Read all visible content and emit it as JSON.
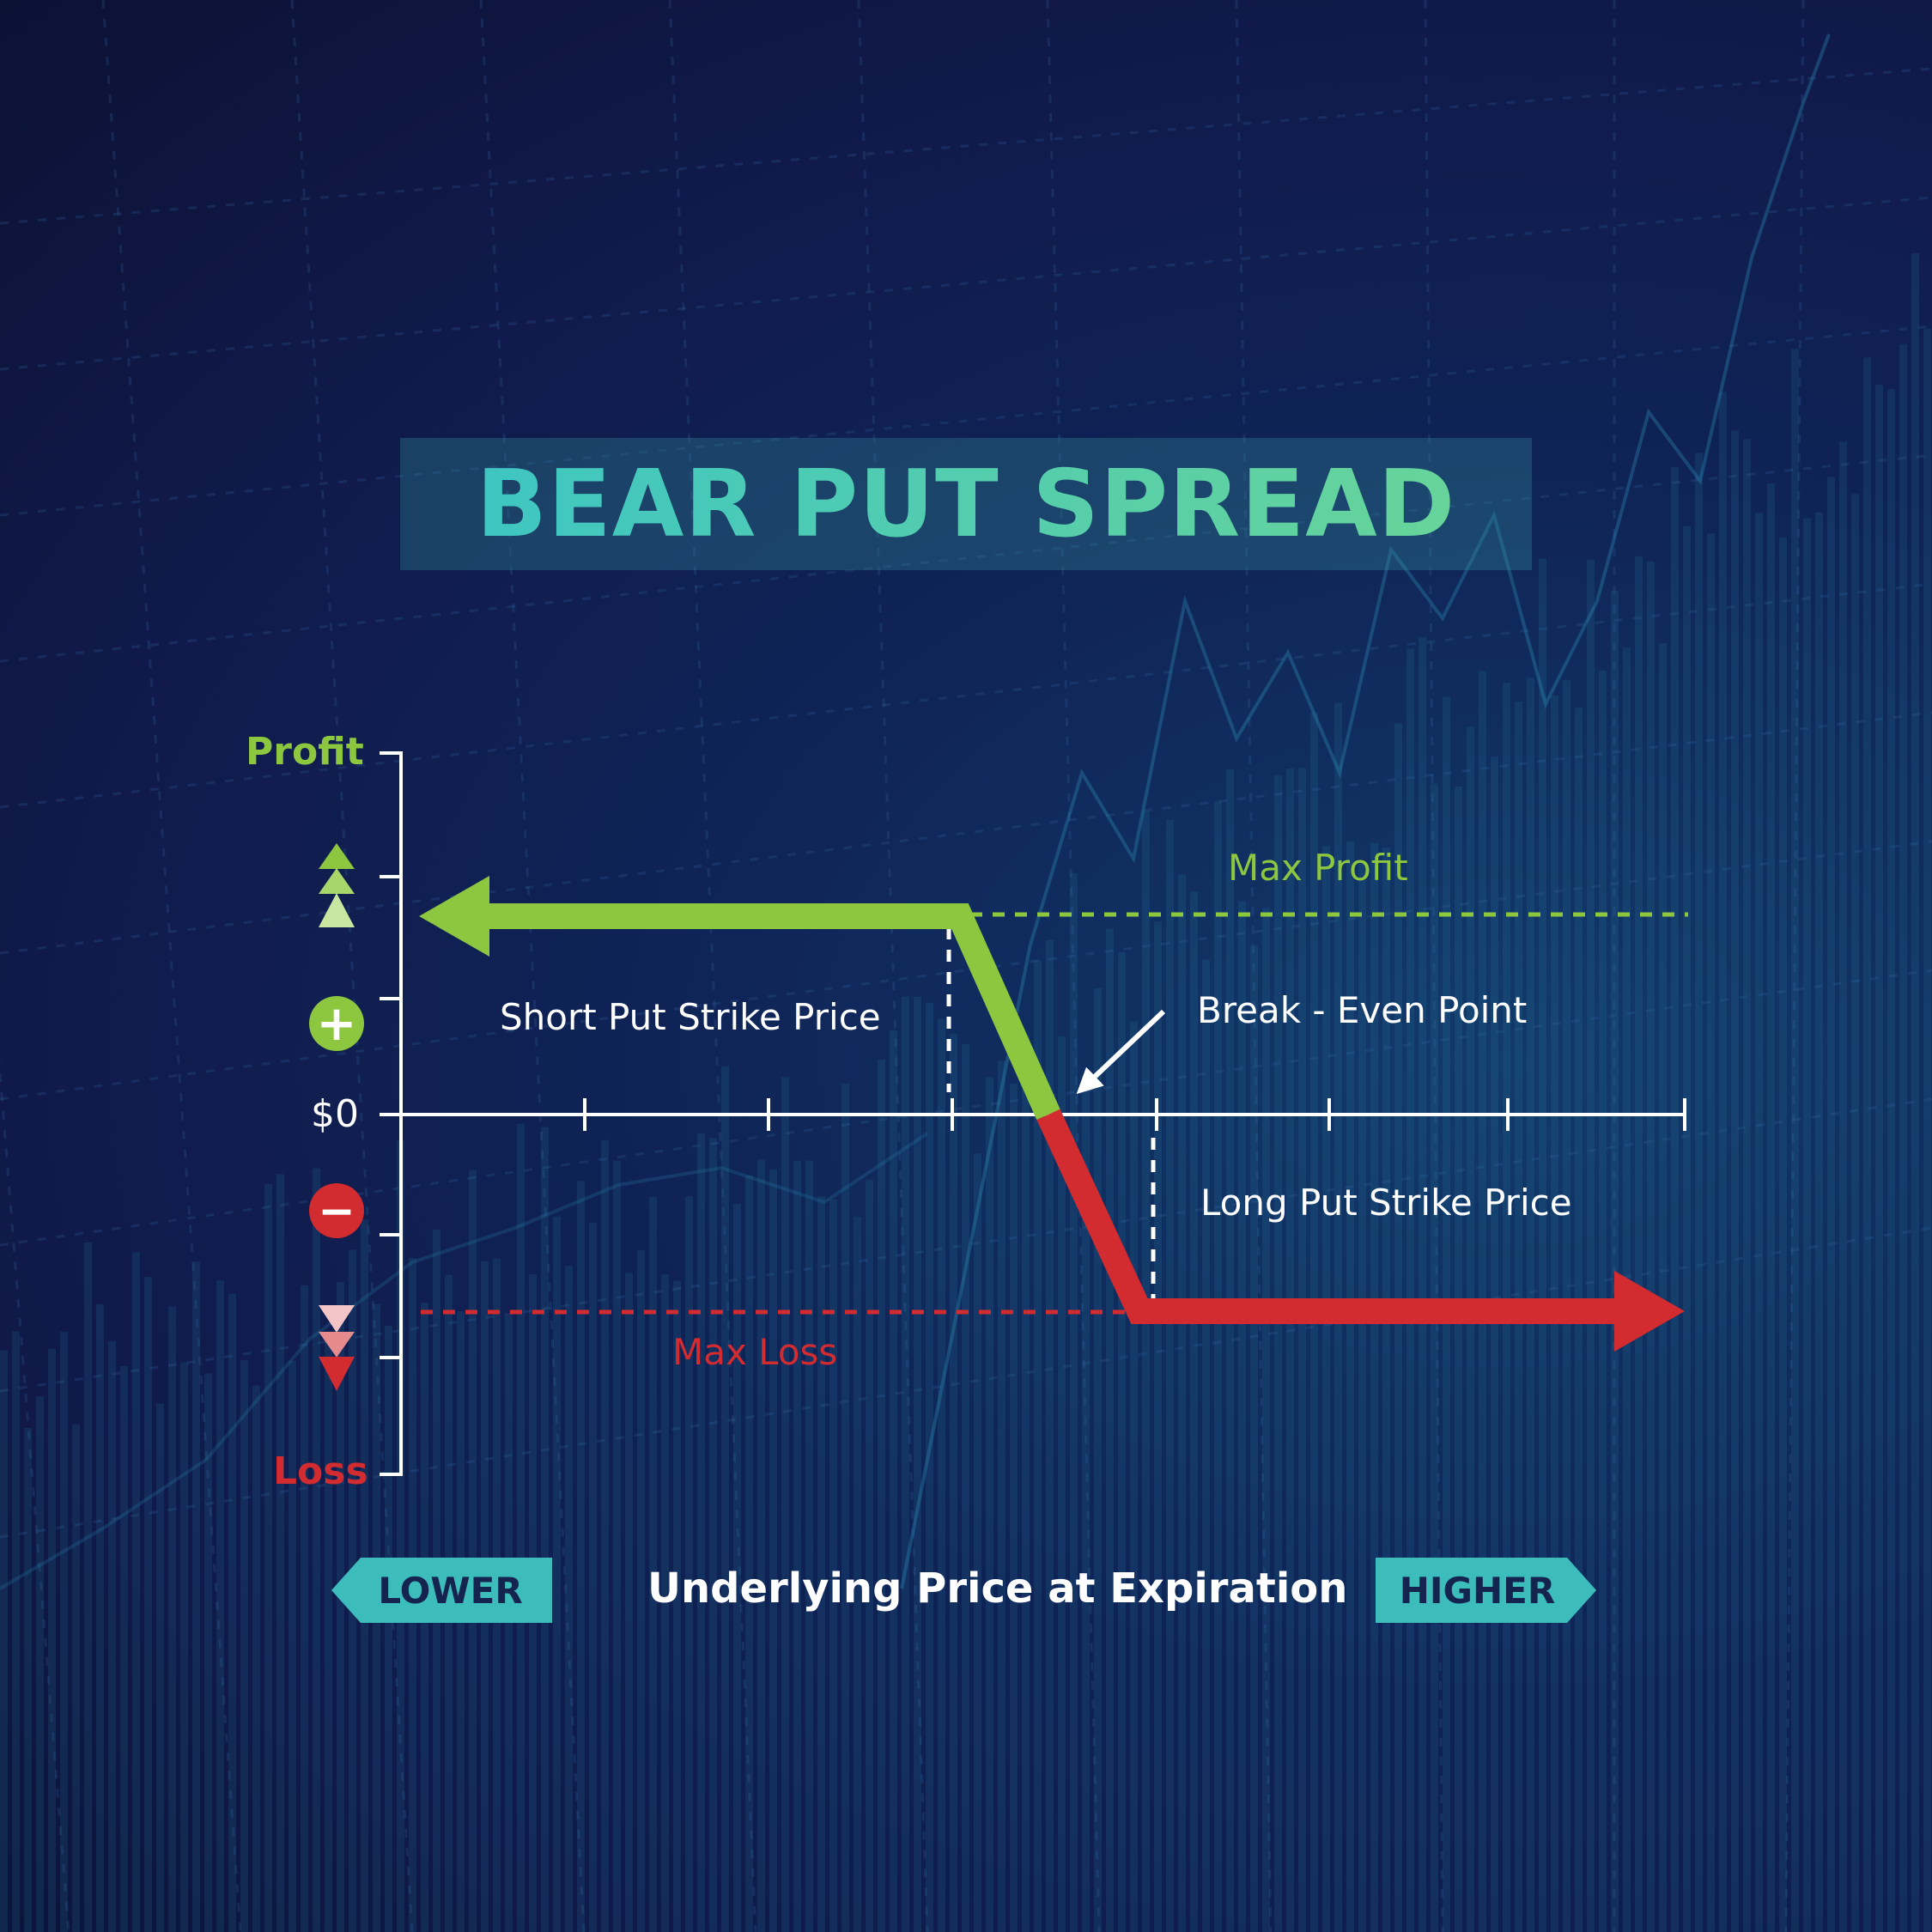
{
  "title": "BEAR PUT SPREAD",
  "y_axis": {
    "top_label": "Profit",
    "bottom_label": "Loss",
    "zero_label": "$0",
    "plus_symbol": "+",
    "minus_symbol": "−"
  },
  "annotations": {
    "max_profit": "Max Profit",
    "max_loss": "Max Loss",
    "short_put_strike": "Short Put Strike Price",
    "long_put_strike": "Long Put Strike Price",
    "break_even": "Break - Even Point"
  },
  "x_axis": {
    "title": "Underlying Price at Expiration",
    "lower_label": "LOWER",
    "higher_label": "HIGHER"
  },
  "colors": {
    "profit": "#8dc63f",
    "loss": "#d22b30",
    "accent": "#3dbcbc",
    "background": "#101a4a"
  },
  "icons": [
    "up-triangles-icon",
    "plus-circle-icon",
    "minus-circle-icon",
    "down-triangles-icon",
    "arrow-icon"
  ]
}
